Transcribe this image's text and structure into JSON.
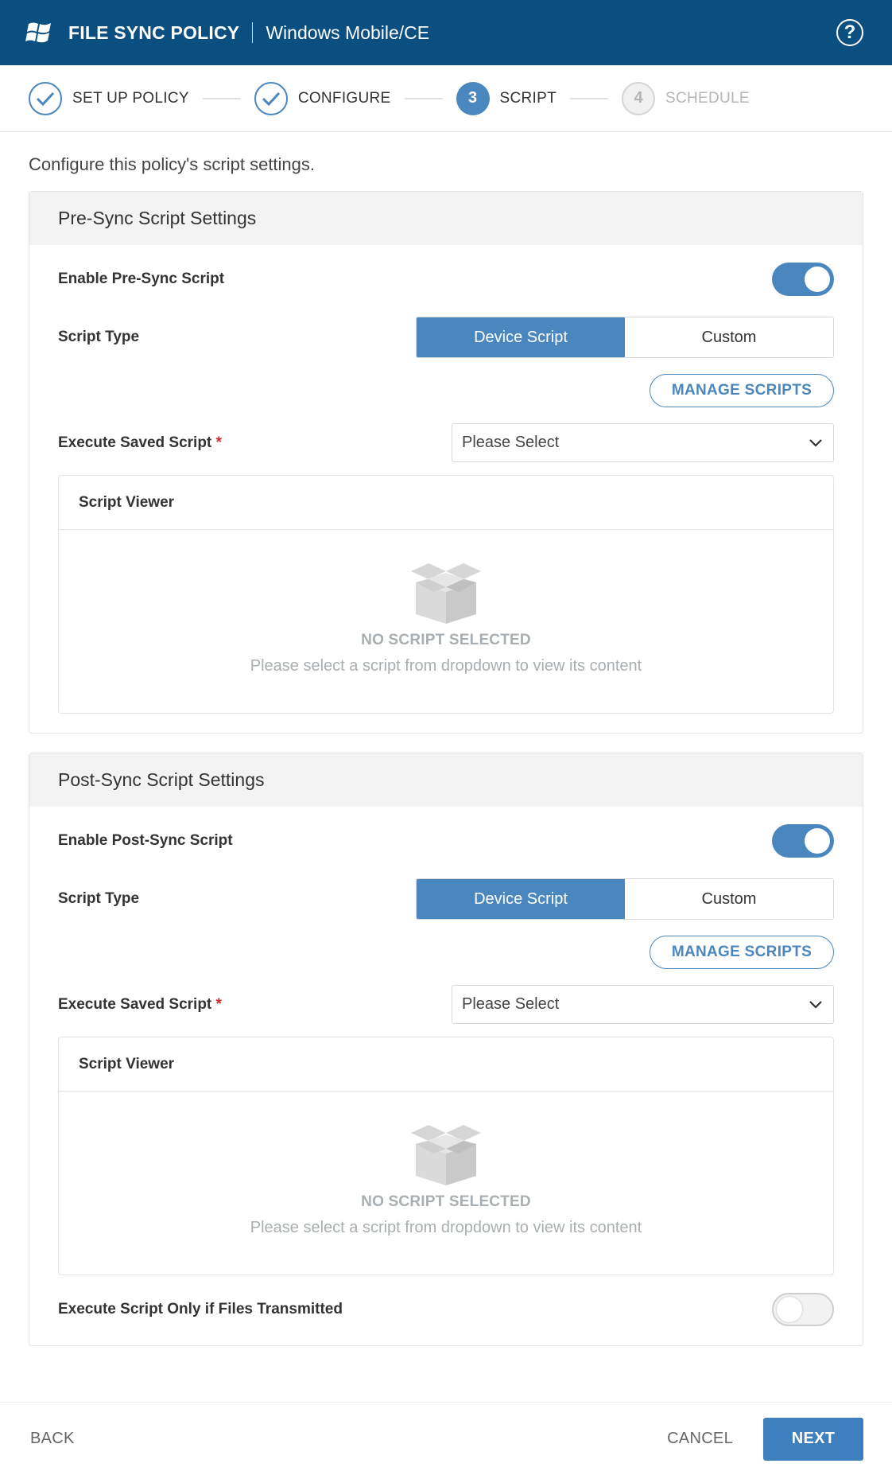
{
  "header": {
    "title": "FILE SYNC POLICY",
    "subtitle": "Windows Mobile/CE",
    "help_icon": "question-circle-icon",
    "logo_icon": "windows-logo-icon"
  },
  "stepper": {
    "steps": [
      {
        "label": "SET UP POLICY",
        "number": "",
        "state": "done"
      },
      {
        "label": "CONFIGURE",
        "number": "",
        "state": "done"
      },
      {
        "label": "SCRIPT",
        "number": "3",
        "state": "active"
      },
      {
        "label": "SCHEDULE",
        "number": "4",
        "state": "future"
      }
    ]
  },
  "intro": "Configure this policy's script settings.",
  "pre_sync": {
    "title": "Pre-Sync Script Settings",
    "enable_label": "Enable Pre-Sync Script",
    "enable_on": true,
    "script_type_label": "Script Type",
    "script_type_options": [
      "Device Script",
      "Custom"
    ],
    "script_type_selected": "Device Script",
    "manage_label": "MANAGE SCRIPTS",
    "execute_label": "Execute Saved Script",
    "required_mark": "*",
    "select_value": "Please Select",
    "viewer_title": "Script Viewer",
    "empty_title": "NO SCRIPT SELECTED",
    "empty_sub": "Please select a script from dropdown to view its content"
  },
  "post_sync": {
    "title": "Post-Sync Script Settings",
    "enable_label": "Enable Post-Sync Script",
    "enable_on": true,
    "script_type_label": "Script Type",
    "script_type_options": [
      "Device Script",
      "Custom"
    ],
    "script_type_selected": "Device Script",
    "manage_label": "MANAGE SCRIPTS",
    "execute_label": "Execute Saved Script",
    "required_mark": "*",
    "select_value": "Please Select",
    "viewer_title": "Script Viewer",
    "empty_title": "NO SCRIPT SELECTED",
    "empty_sub": "Please select a script from dropdown to view its content",
    "transmitted_label": "Execute Script Only if Files Transmitted",
    "transmitted_on": false
  },
  "footer": {
    "back_label": "BACK",
    "cancel_label": "CANCEL",
    "next_label": "NEXT"
  },
  "colors": {
    "header_bg": "#0b4f80",
    "accent": "#4a87be",
    "required": "#d02c2c"
  }
}
